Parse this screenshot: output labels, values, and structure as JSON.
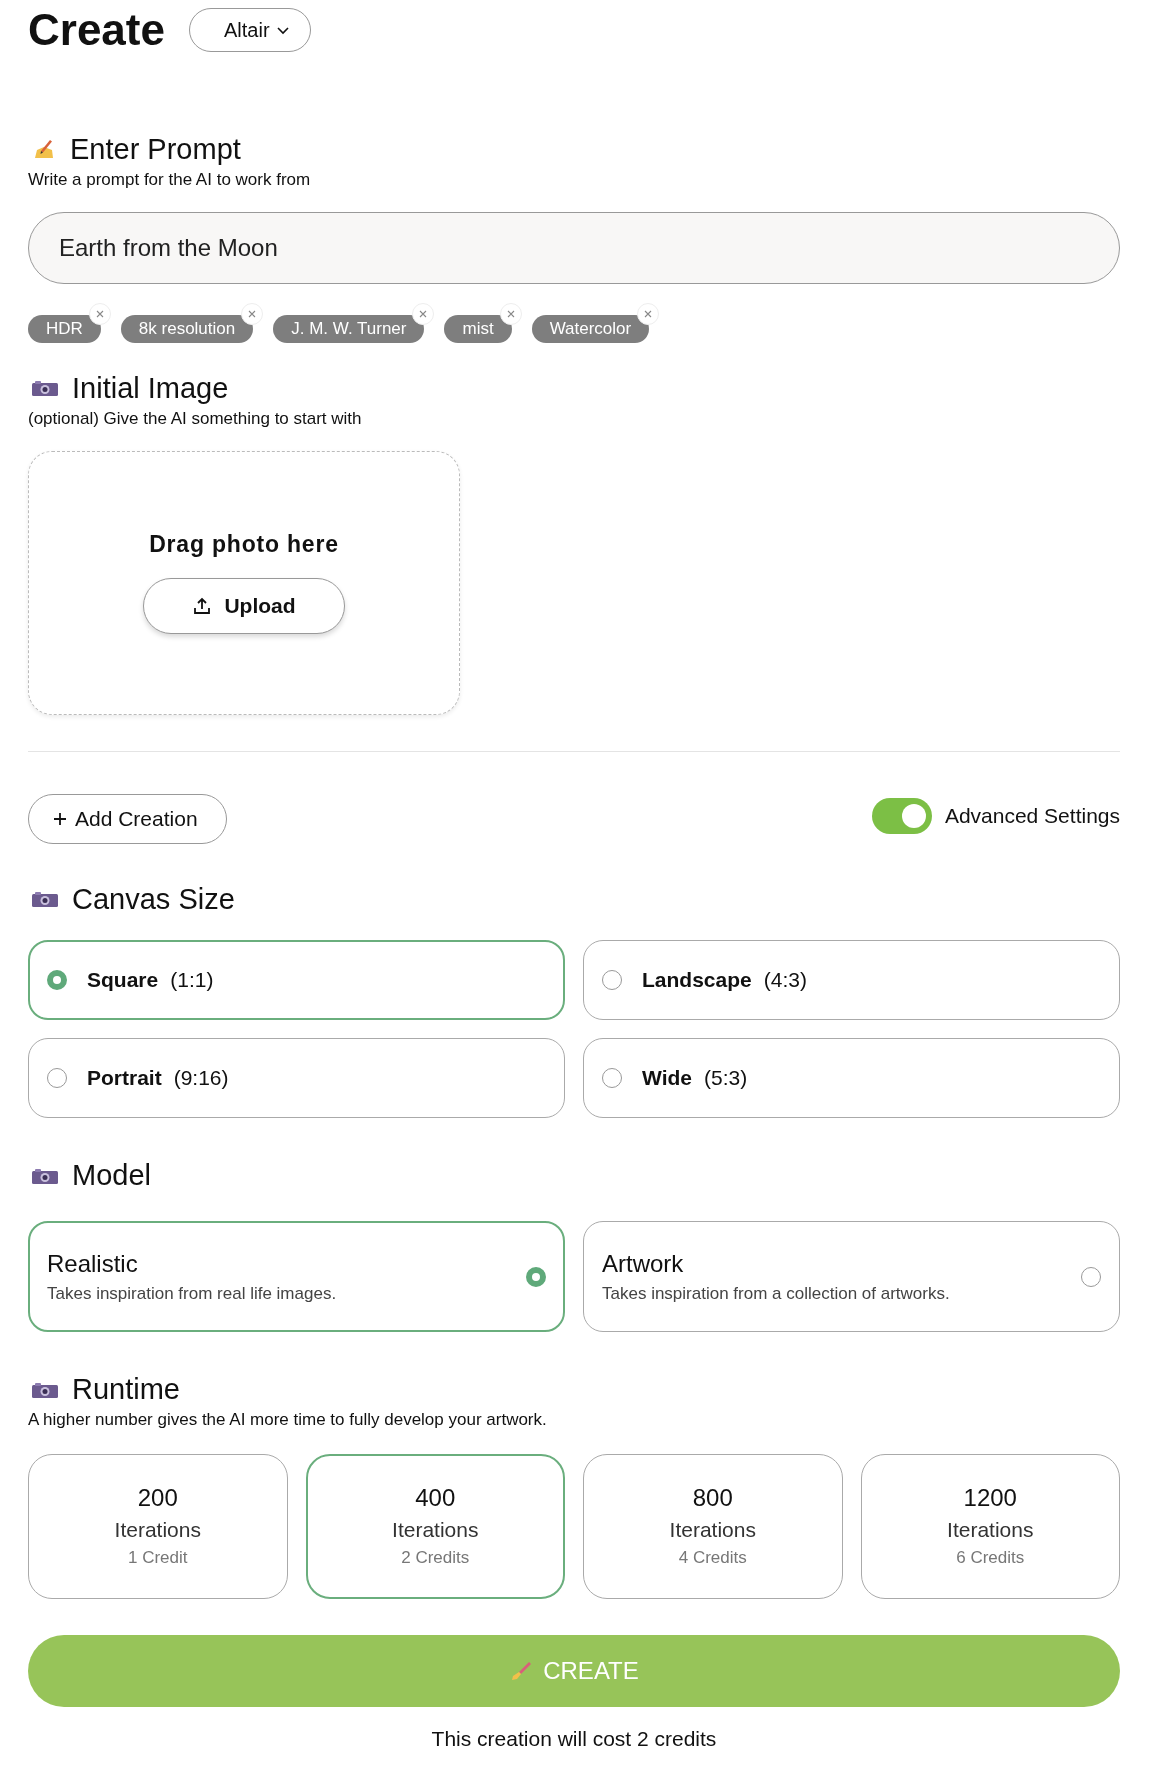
{
  "header": {
    "title": "Create",
    "dropdown": "Altair"
  },
  "prompt": {
    "title": "Enter Prompt",
    "subtitle": "Write a prompt for the AI to work from",
    "value": "Earth from the Moon",
    "tags": [
      "HDR",
      "8k resolution",
      "J. M. W. Turner",
      "mist",
      "Watercolor"
    ]
  },
  "initial_image": {
    "title": "Initial Image",
    "subtitle": "(optional) Give the AI something to start with",
    "drop_label": "Drag photo here",
    "upload_button": "Upload"
  },
  "add_creation": "Add Creation",
  "advanced_settings": {
    "label": "Advanced Settings",
    "on": true
  },
  "canvas_size": {
    "title": "Canvas Size",
    "options": [
      {
        "name": "Square",
        "ratio": "(1:1)",
        "selected": true
      },
      {
        "name": "Landscape",
        "ratio": "(4:3)",
        "selected": false
      },
      {
        "name": "Portrait",
        "ratio": "(9:16)",
        "selected": false
      },
      {
        "name": "Wide",
        "ratio": "(5:3)",
        "selected": false
      }
    ]
  },
  "model": {
    "title": "Model",
    "options": [
      {
        "name": "Realistic",
        "description": "Takes inspiration from real life images.",
        "selected": true
      },
      {
        "name": "Artwork",
        "description": "Takes inspiration from a collection of artworks.",
        "selected": false
      }
    ]
  },
  "runtime": {
    "title": "Runtime",
    "subtitle": "A higher number gives the AI more time to fully develop your artwork.",
    "options": [
      {
        "value": "200",
        "unit": "Iterations",
        "cost": "1 Credit",
        "selected": false
      },
      {
        "value": "400",
        "unit": "Iterations",
        "cost": "2 Credits",
        "selected": true
      },
      {
        "value": "800",
        "unit": "Iterations",
        "cost": "4 Credits",
        "selected": false
      },
      {
        "value": "1200",
        "unit": "Iterations",
        "cost": "6 Credits",
        "selected": false
      }
    ]
  },
  "create_button": "CREATE",
  "cost_note": "This creation will cost 2 credits"
}
